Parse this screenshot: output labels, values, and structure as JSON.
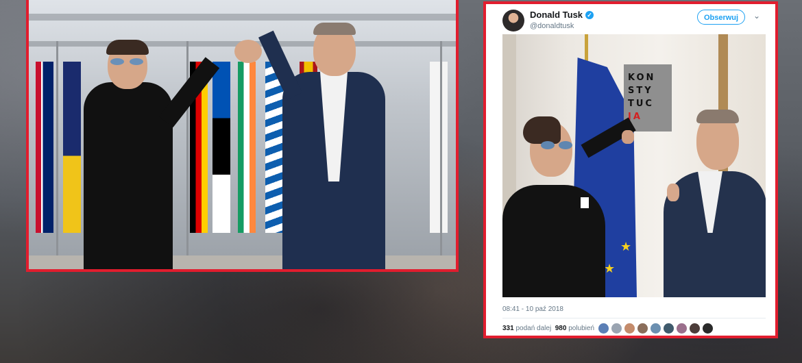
{
  "tweet": {
    "author_name": "Donald Tusk",
    "handle": "@donaldtusk",
    "follow_label": "Obserwuj",
    "caret": "⌄",
    "poster_lines": [
      {
        "plain": "KON",
        "red": ""
      },
      {
        "plain": "STY",
        "red": ""
      },
      {
        "plain": "TUC",
        "red": ""
      },
      {
        "plain": "",
        "red": "JA"
      }
    ],
    "timestamp": "08:41 - 10 paź 2018",
    "retweets_count": "331",
    "retweets_label": "podań dalej",
    "likes_count": "980",
    "likes_label": "polubień",
    "liker_colors": [
      "#5b7fb6",
      "#9aa4b1",
      "#c48b6b",
      "#8a6d5a",
      "#6b8fb0",
      "#3f5a6c",
      "#9b6f8c",
      "#4c3d3a",
      "#2a2a2a"
    ]
  },
  "colors": {
    "frame_red": "#e11d2e",
    "twitter_blue": "#1da1f2",
    "eu_blue": "#1f3fa0",
    "eu_gold": "#f7d11e"
  }
}
